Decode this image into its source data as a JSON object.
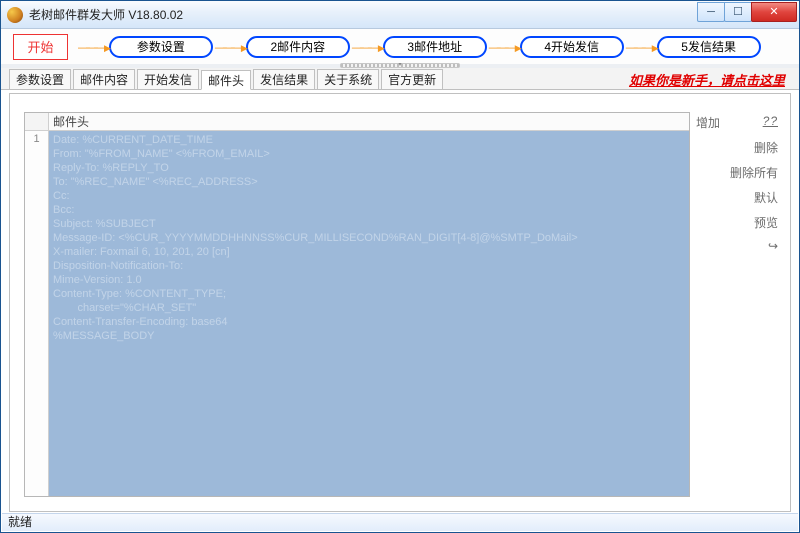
{
  "window": {
    "title": "老树邮件群发大师 V18.80.02",
    "min_label": "─",
    "max_label": "☐",
    "close_label": "✕"
  },
  "start_button": "开始",
  "steps": [
    "参数设置",
    "2邮件内容",
    "3邮件地址",
    "4开始发信",
    "5发信结果"
  ],
  "arrow_glyph": "———",
  "grip_glyph": "▾",
  "tabs": [
    "参数设置",
    "邮件内容",
    "开始发信",
    "邮件头",
    "发信结果",
    "关于系统",
    "官方更新"
  ],
  "active_tab_index": 3,
  "help_link": "如果你是新手，请点击这里",
  "sidebar": {
    "add": "增加",
    "del": "删除",
    "del_all": "删除所有",
    "defaults": "默认",
    "preview": "预览",
    "question": "??"
  },
  "editor_column": "邮件头",
  "line_no": "1",
  "editor_lines": [
    "Date: %CURRENT_DATE_TIME",
    "From: \"%FROM_NAME\" <%FROM_EMAIL>",
    "Reply-To: %REPLY_TO",
    "To: \"%REC_NAME\" <%REC_ADDRESS>",
    "Cc:",
    "Bcc:",
    "Subject: %SUBJECT",
    "Message-ID: <%CUR_YYYYMMDDHHNNSS%CUR_MILLISECOND%RAN_DIGIT[4-8]@%SMTP_DoMail>",
    "X-mailer: Foxmail 6, 10, 201, 20 [cn]",
    "Disposition-Notification-To:",
    "Mime-Version: 1.0",
    "Content-Type: %CONTENT_TYPE;",
    "        charset=\"%CHAR_SET\"",
    "Content-Transfer-Encoding: base64",
    "",
    "%MESSAGE_BODY"
  ],
  "status": "就绪"
}
